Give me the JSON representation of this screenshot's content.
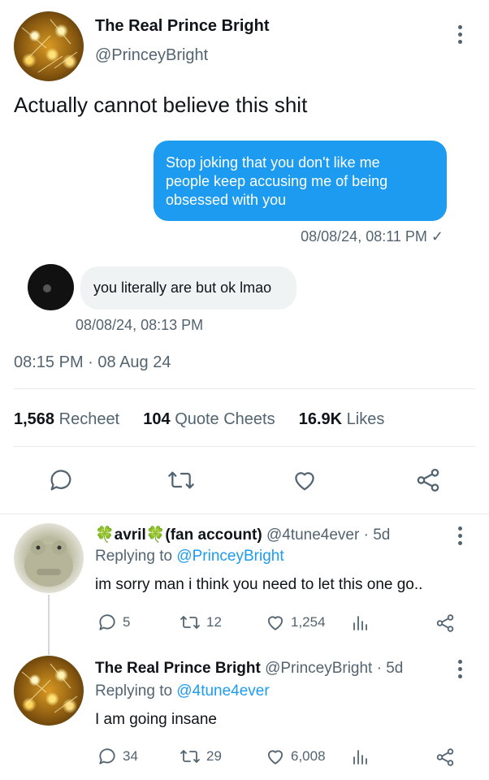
{
  "tweet": {
    "author_name": "The Real Prince Bright",
    "author_handle": "@PrinceyBright",
    "text": "Actually cannot believe this shit",
    "timestamp": "08:15 PM · 08 Aug 24"
  },
  "screenshot": {
    "sent_message": "Stop joking that you don't like me people keep accusing me of being obsessed with you",
    "sent_time": "08/08/24, 08:11 PM ✓",
    "received_message": "you literally are but ok lmao",
    "received_time": "08/08/24, 08:13 PM"
  },
  "stats": {
    "recheets_count": "1,568",
    "recheets_label": "Recheet",
    "quotes_count": "104",
    "quotes_label": "Quote Cheets",
    "likes_count": "16.9K",
    "likes_label": "Likes"
  },
  "replies": [
    {
      "name": "🍀avril🍀(fan account)",
      "handle": "@4tune4ever",
      "age": "· 5d",
      "replying_prefix": "Replying to",
      "replying_to": "@PrinceyBright",
      "text": "im sorry man i think you need to let this one go..",
      "comments": "5",
      "recheets": "12",
      "likes": "1,254"
    },
    {
      "name": "The Real Prince Bright",
      "handle": "@PrinceyBright",
      "age": "· 5d",
      "replying_prefix": "Replying to",
      "replying_to": "@4tune4ever",
      "text": "I am going insane",
      "comments": "34",
      "recheets": "29",
      "likes": "6,008"
    }
  ],
  "colors": {
    "accent": "#1d9bf0",
    "muted": "#536471",
    "divider": "#e7e9ea"
  },
  "icons": [
    "more-icon",
    "reply-icon",
    "retweet-icon",
    "like-icon",
    "share-icon",
    "views-icon"
  ]
}
